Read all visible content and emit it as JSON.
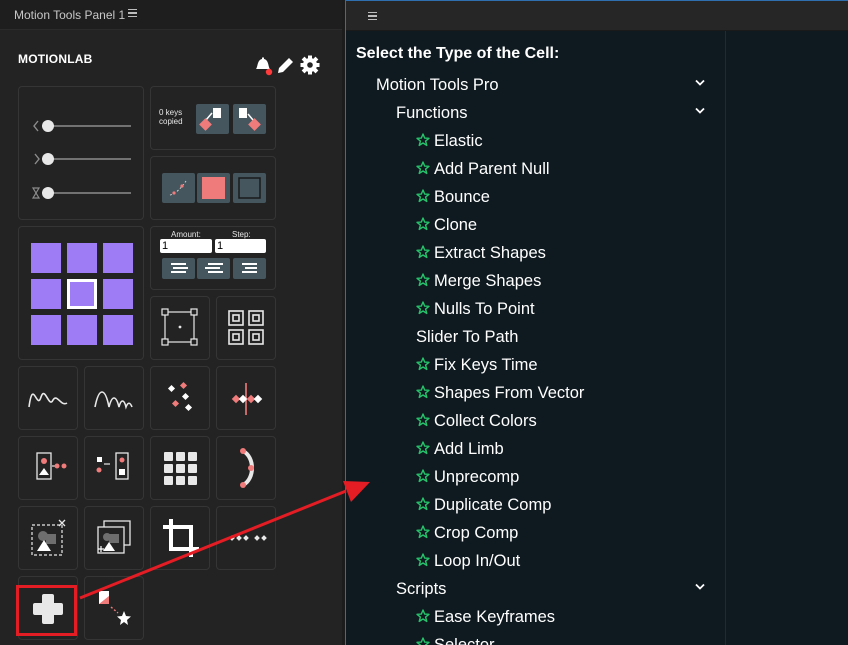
{
  "left_panel": {
    "tab_title": "Motion Tools Panel 1",
    "brand": "MOTIONLAB",
    "keys_label": "0 keys\ncopied",
    "amount_label": "Amount:",
    "step_label": "Step:",
    "amount_value": "1",
    "step_value": "1"
  },
  "right_panel": {
    "heading": "Select the Type of the Cell:",
    "tree": [
      {
        "label": "Motion Tools Pro",
        "level": 0,
        "star": false,
        "chevron": true
      },
      {
        "label": "Functions",
        "level": 1,
        "star": false,
        "chevron": true
      },
      {
        "label": "Elastic",
        "level": 2,
        "star": true
      },
      {
        "label": "Add Parent Null",
        "level": 2,
        "star": true
      },
      {
        "label": "Bounce",
        "level": 2,
        "star": true
      },
      {
        "label": "Clone",
        "level": 2,
        "star": true
      },
      {
        "label": "Extract Shapes",
        "level": 2,
        "star": true
      },
      {
        "label": "Merge Shapes",
        "level": 2,
        "star": true
      },
      {
        "label": "Nulls To Point",
        "level": 2,
        "star": true
      },
      {
        "label": "Slider To Path",
        "level": 2,
        "star": false
      },
      {
        "label": "Fix Keys Time",
        "level": 2,
        "star": true
      },
      {
        "label": "Shapes From Vector",
        "level": 2,
        "star": true
      },
      {
        "label": "Collect Colors",
        "level": 2,
        "star": true
      },
      {
        "label": "Add Limb",
        "level": 2,
        "star": true
      },
      {
        "label": "Unprecomp",
        "level": 2,
        "star": true
      },
      {
        "label": "Duplicate Comp",
        "level": 2,
        "star": true
      },
      {
        "label": "Crop Comp",
        "level": 2,
        "star": true
      },
      {
        "label": "Loop In/Out",
        "level": 2,
        "star": true
      },
      {
        "label": "Scripts",
        "level": 1,
        "star": false,
        "chevron": true
      },
      {
        "label": "Ease Keyframes",
        "level": 2,
        "star": true
      },
      {
        "label": "Selector",
        "level": 2,
        "star": true
      }
    ]
  },
  "colors": {
    "accent_pink": "#f07b7b",
    "purple": "#9d7cf5",
    "star_green": "#27c46b",
    "annotation_red": "#e41c24"
  }
}
